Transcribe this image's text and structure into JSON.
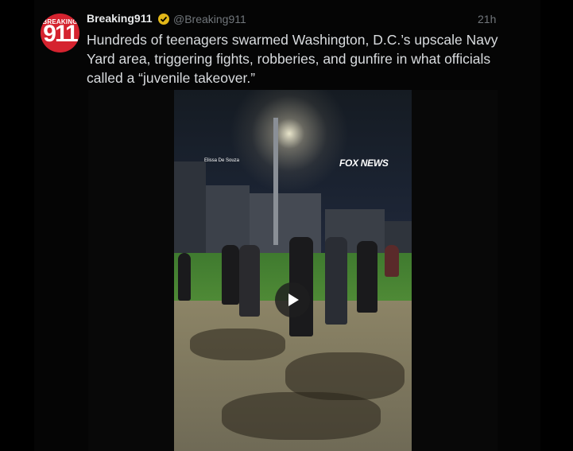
{
  "tweet": {
    "avatar": {
      "brand_top": "BREAKING",
      "brand_number": "911"
    },
    "author_name": "Breaking911",
    "verified": true,
    "handle": "@Breaking911",
    "time": "21h",
    "text": "Hundreds of teenagers swarmed Washington, D.C.’s upscale Navy Yard area, triggering fights, robberies, and gunfire in what officials called a “juvenile takeover.”",
    "media": {
      "type": "video",
      "watermark": "FOX NEWS",
      "credit": "Elissa De Souza",
      "controls": {
        "play_icon": "play-icon"
      }
    }
  },
  "colors": {
    "background": "#000000",
    "text": "#d9dcdf",
    "muted": "#71767b",
    "avatar": "#d5232f",
    "verified": "#e2b719"
  }
}
